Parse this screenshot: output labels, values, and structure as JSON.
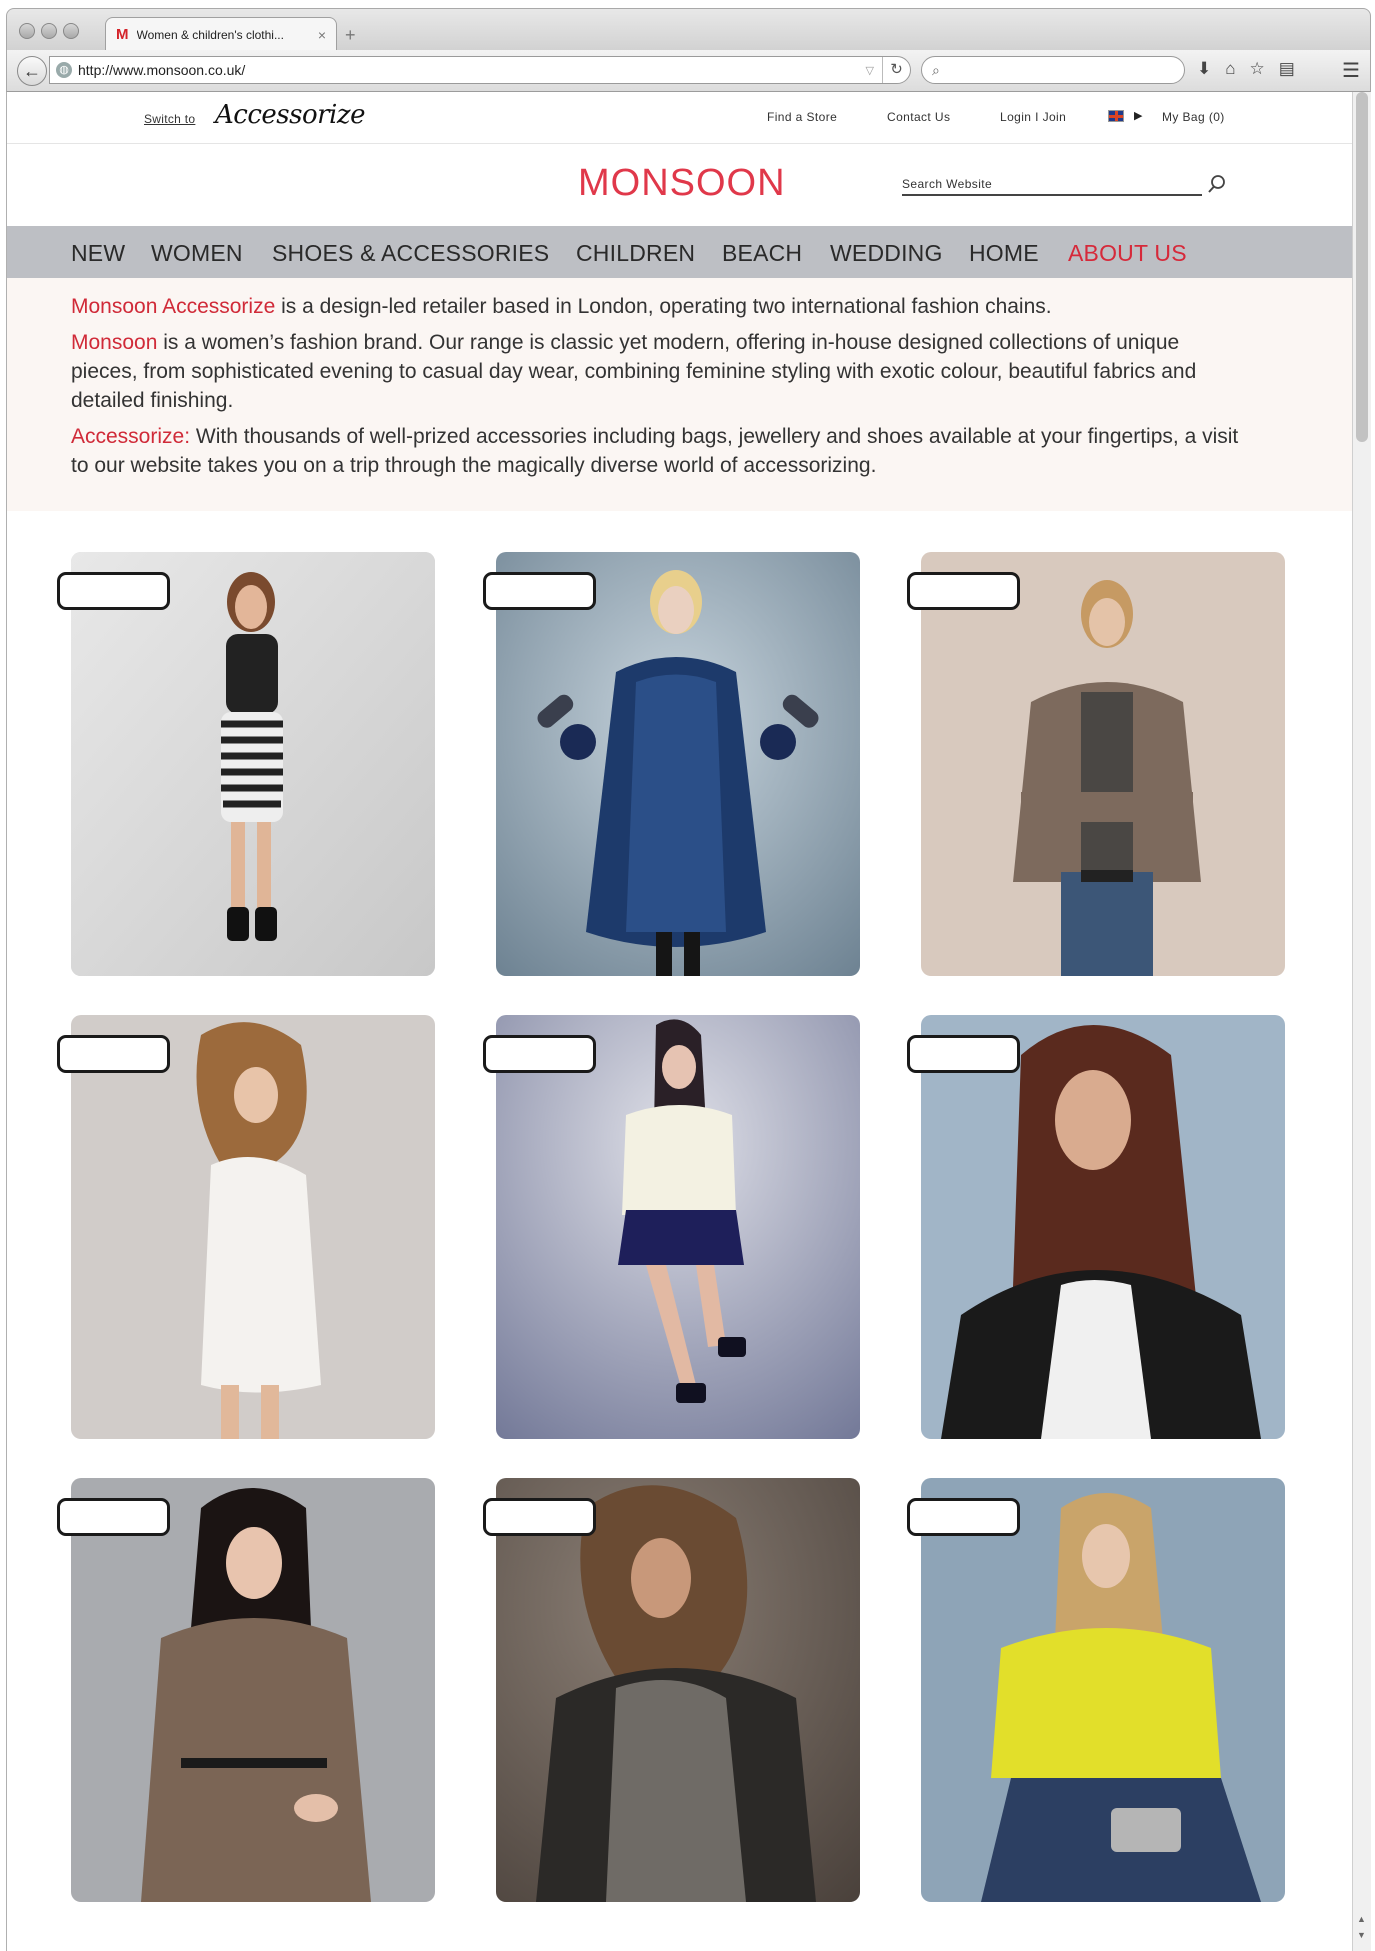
{
  "browser": {
    "tab_title": "Women & children's clothi...",
    "tab_favicon": "M",
    "tab_close": "×",
    "new_tab": "+",
    "url": "http://www.monsoon.co.uk/",
    "search_icon": "search-icon",
    "icons": [
      "download-icon",
      "home-icon",
      "bookmark-star-icon",
      "clipboard-icon"
    ]
  },
  "utility_bar": {
    "switch_to": "Switch to",
    "accessorize_logo": "Accessorize",
    "find_store": "Find a Store",
    "contact_us": "Contact Us",
    "login_join": "Login I Join",
    "my_bag": "My Bag (0)"
  },
  "header": {
    "logo": "MONSOON",
    "search_placeholder": "Search Website",
    "brand_color": "#e0384a"
  },
  "nav": {
    "items": [
      "NEW",
      "WOMEN",
      "SHOES & ACCESSORIES",
      "CHILDREN",
      "BEACH",
      "WEDDING",
      "HOME",
      "ABOUT US"
    ],
    "active": "ABOUT US"
  },
  "about": {
    "p1_highlight": "Monsoon Accessorize",
    "p1_text": " is a design-led retailer based in London, operating two international fashion chains.",
    "p2_highlight": "Monsoon",
    "p2_text": " is a women’s fashion brand. Our range is classic yet modern, offering in-house designed collections of unique pieces, from sophisticated evening to casual day wear, combining feminine styling with exotic colour, beautiful fabrics and detailed finishing.",
    "p3_highlight": "Accessorize:",
    "p3_text": " With thousands of well-prized accessories including bags, jewellery and shoes available at your fingertips, a visit to our website takes you on a trip through the magically diverse world of accessorizing."
  },
  "products": [
    {
      "name": "striped-skirt-look",
      "bg": "#d9d9d9"
    },
    {
      "name": "blue-puffer-coat-look",
      "bg": "#8ea3b3"
    },
    {
      "name": "brown-blazer-look",
      "bg": "#d6c8bf"
    },
    {
      "name": "white-dress-look",
      "bg": "#d3cecb"
    },
    {
      "name": "navy-shorts-look",
      "bg": "#9aa1b9"
    },
    {
      "name": "leather-jacket-look",
      "bg": "#9fb3c6"
    },
    {
      "name": "tweed-coat-look",
      "bg": "#a7a9ad"
    },
    {
      "name": "wrap-coat-look",
      "bg": "#6d625a"
    },
    {
      "name": "yellow-sweater-look",
      "bg": "#8fa5b8"
    }
  ]
}
